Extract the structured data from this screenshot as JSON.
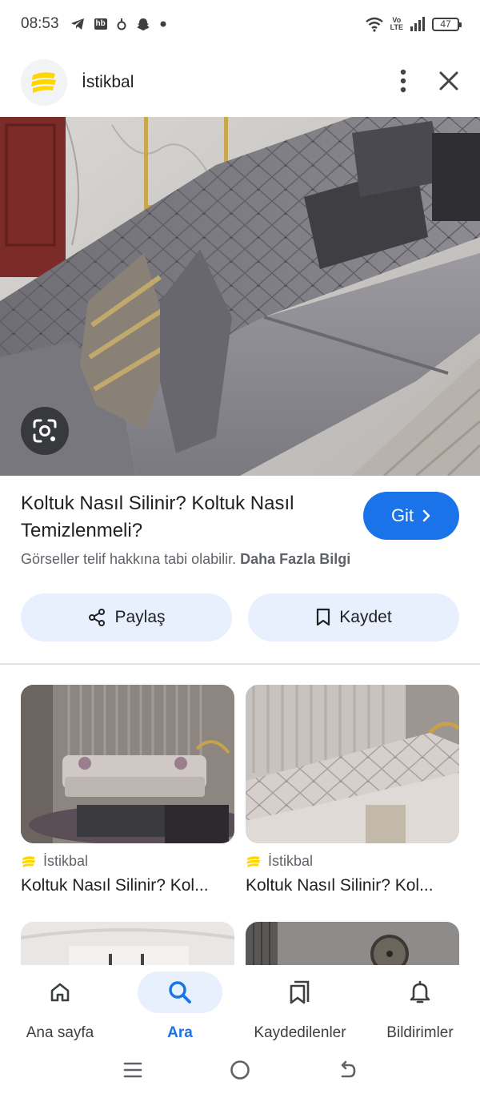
{
  "status_bar": {
    "time": "08:53",
    "left_icons": [
      "telegram-icon",
      "hb-icon",
      "notification-icon",
      "snapchat-icon",
      "dot-icon"
    ],
    "hb_label": "hb",
    "volte_label_top": "Vo",
    "volte_label_bottom": "LTE",
    "battery": "47"
  },
  "header": {
    "site_name": "İstikbal",
    "logo_color": "#ffd600"
  },
  "hero": {
    "lens_icon": "google-lens-icon"
  },
  "result": {
    "title": "Koltuk Nasıl Silinir? Koltuk Nasıl Temizlenmeli?",
    "go_label": "Git",
    "copyright_text": "Görseller telif hakkına tabi olabilir.",
    "more_info": "Daha Fazla Bilgi"
  },
  "actions": {
    "share_label": "Paylaş",
    "save_label": "Kaydet"
  },
  "related": [
    {
      "source": "İstikbal",
      "title": "Koltuk Nasıl Silinir? Kol..."
    },
    {
      "source": "İstikbal",
      "title": "Koltuk Nasıl Silinir? Kol..."
    }
  ],
  "bottom_nav": {
    "items": [
      {
        "label": "Ana sayfa",
        "icon": "home-icon"
      },
      {
        "label": "Ara",
        "icon": "search-icon",
        "active": true
      },
      {
        "label": "Kaydedilenler",
        "icon": "saved-icon"
      },
      {
        "label": "Bildirimler",
        "icon": "bell-icon"
      }
    ]
  },
  "colors": {
    "accent": "#1a73e8",
    "pill_background": "#e8f0fe",
    "brand_yellow": "#ffd600"
  }
}
